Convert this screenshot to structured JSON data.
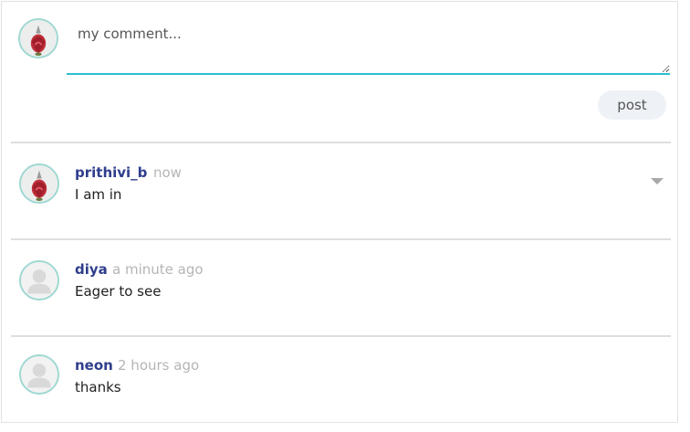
{
  "composer": {
    "placeholder": "my comment...",
    "post_label": "post"
  },
  "comments": [
    {
      "author": "prithivi_b",
      "time": "now",
      "text": "I am in",
      "avatar": "rose-photo"
    },
    {
      "author": "diya",
      "time": "a minute ago",
      "text": "Eager to see",
      "avatar": "default-user"
    },
    {
      "author": "neon",
      "time": "2 hours ago",
      "text": "thanks",
      "avatar": "default-user"
    }
  ],
  "colors": {
    "author": "#2f3e8c",
    "timestamp": "#b5b5b5",
    "input_underline": "#2cc0cf",
    "avatar_ring": "#9ed8d2",
    "post_button_bg": "#eef2f6"
  }
}
